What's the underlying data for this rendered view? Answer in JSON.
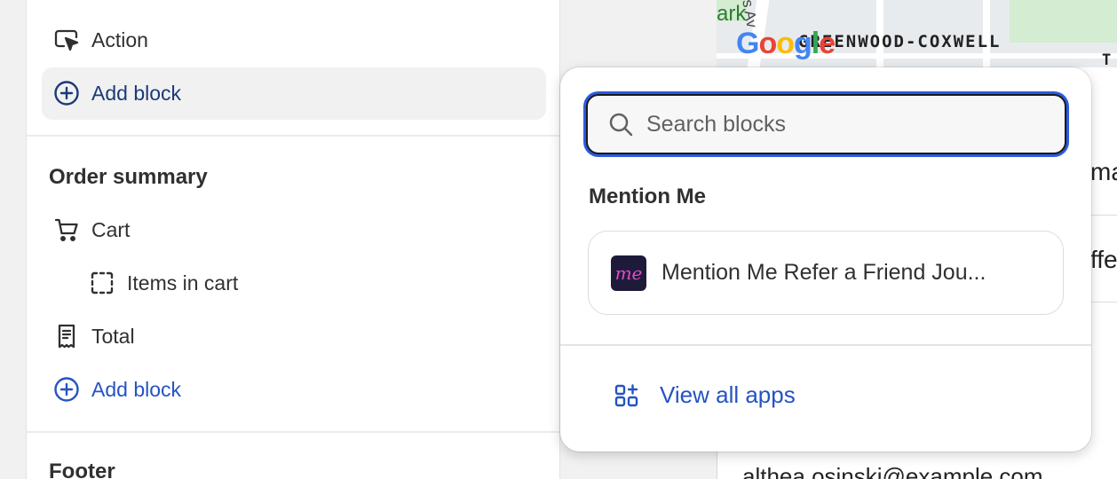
{
  "sidebar": {
    "action_label": "Action",
    "add_block_top": "Add block",
    "order_summary_title": "Order summary",
    "cart_label": "Cart",
    "items_in_cart_label": "Items in cart",
    "total_label": "Total",
    "add_block_bottom": "Add block",
    "footer_title": "Footer"
  },
  "canvas": {
    "map_label": "GREENWOOD-COXWELL",
    "map_park_fragment": "ark",
    "map_street_fragment": "s Av",
    "map_t_fragment": "T",
    "text_ma": "ma",
    "text_ffe": "ffe",
    "email_fragment": "althea.osinski@example.com",
    "google_letters": [
      "G",
      "o",
      "o",
      "g",
      "l",
      "e"
    ]
  },
  "popover": {
    "search_placeholder": "Search blocks",
    "group_title": "Mention Me",
    "app_logo_text": "me",
    "app_name": "Mention Me Refer a Friend Jou...",
    "view_all_label": "View all apps"
  },
  "colors": {
    "accent": "#2453c4",
    "focus_ring": "#2c5ae0",
    "mention_me_logo_bg": "#1e1b3a",
    "mention_me_logo_fg": "#e24bc4"
  },
  "icons": {
    "action": "cursor-click-icon",
    "add": "plus-circle-icon",
    "cart": "cart-icon",
    "items": "dashed-square-icon",
    "total": "receipt-icon",
    "search": "search-icon",
    "apps": "apps-grid-plus-icon"
  }
}
